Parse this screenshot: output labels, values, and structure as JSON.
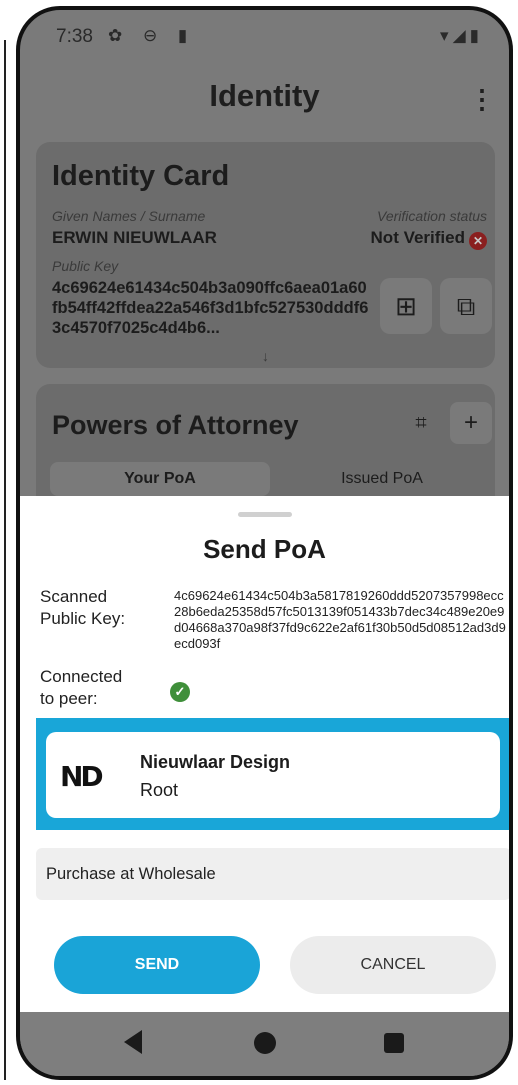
{
  "status_bar": {
    "time": "7:38",
    "left_icons": "✿ ⊖ ▮",
    "right_icons": "▾◢▮"
  },
  "topbar": {
    "title": "Identity",
    "menu_glyph": "⋮"
  },
  "identity_card": {
    "title": "Identity Card",
    "name_label": "Given Names / Surname",
    "name": "ERWIN NIEUWLAAR",
    "status_label": "Verification status",
    "status": "Not Verified",
    "status_icon_glyph": "✕",
    "key_label": "Public Key",
    "public_key": "4c69624e61434c504b3a090ffc6aea01a60fb54ff42ffdea22a546f3d1bfc527530dddf63c4570f7025c4d4b6...",
    "qr_button_glyph": "⊞",
    "copy_button_glyph": "⧉",
    "expand_glyph": "↓"
  },
  "poa_card": {
    "title": "Powers of Attorney",
    "scan_glyph": "⌗",
    "add_glyph": "+",
    "tabs": [
      {
        "label": "Your PoA"
      },
      {
        "label": "Issued PoA"
      }
    ]
  },
  "sheet": {
    "title": "Send PoA",
    "scanned_label": "Scanned\nPublic Key:",
    "scanned_key": "4c69624e61434c504b3a5817819260ddd5207357998ecc28b6eda25358d57fc5013139f051433b7dec34c489e20e9d04668a370a98f37fd9c622e2af61f30b50d5d08512ad3d9ecd093f",
    "peer_label": "Connected\nto peer:",
    "peer_icon_glyph": "✓",
    "selected": {
      "logo_text": "ND",
      "name": "Nieuwlaar Design",
      "role": "Root"
    },
    "purpose_value": "Purchase at Wholesale",
    "send_label": "SEND",
    "cancel_label": "CANCEL"
  },
  "colors": {
    "accent": "#1aa4d7",
    "verified_green": "#3f8f3a",
    "not_verified_red": "#8a1f1f"
  }
}
